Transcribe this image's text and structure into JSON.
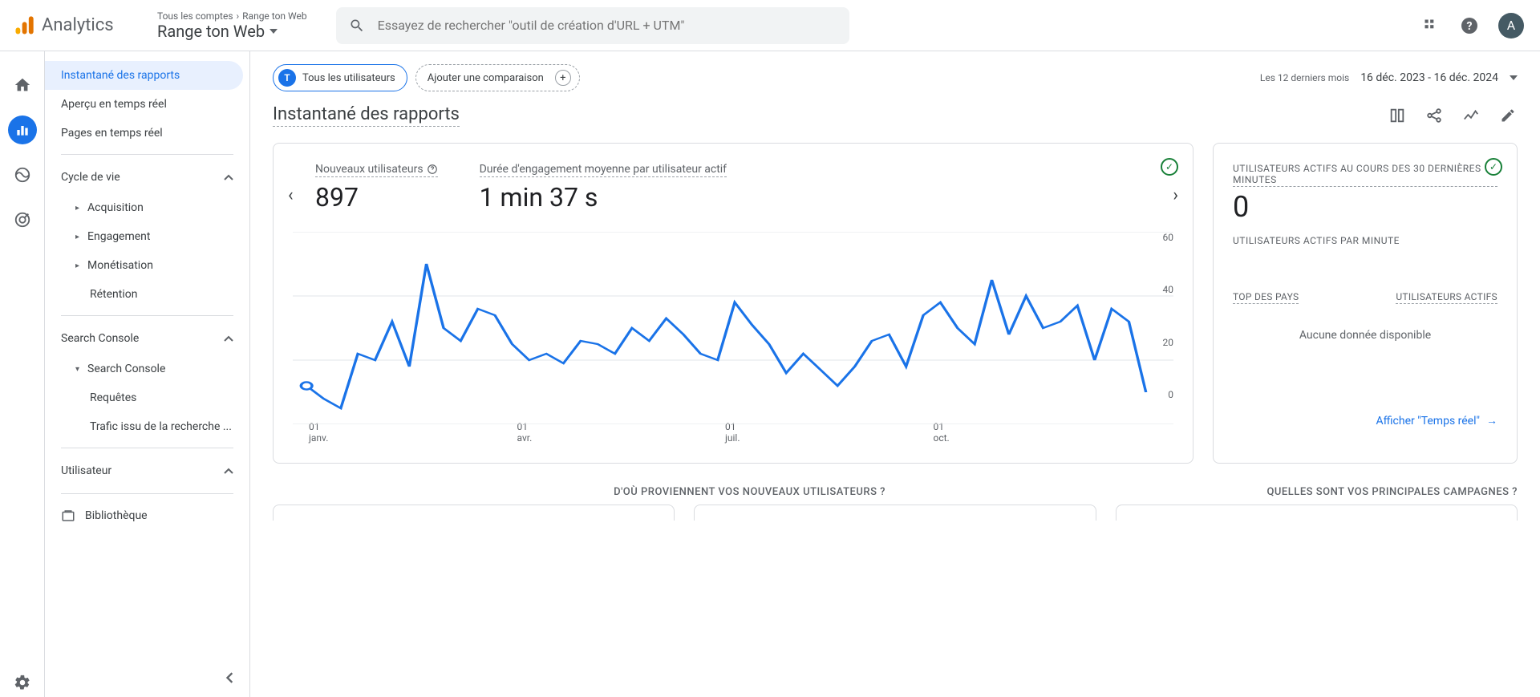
{
  "header": {
    "logo_text": "Analytics",
    "breadcrumb_all": "Tous les comptes",
    "breadcrumb_prop": "Range ton Web",
    "property_name": "Range ton Web",
    "search_placeholder": "Essayez de rechercher \"outil de création d'URL + UTM\"",
    "avatar_initial": "A"
  },
  "sidebar": {
    "items": [
      "Instantané des rapports",
      "Aperçu en temps réel",
      "Pages en temps réel"
    ],
    "group1": "Cycle de vie",
    "group1_items": [
      "Acquisition",
      "Engagement",
      "Monétisation",
      "Rétention"
    ],
    "group2": "Search Console",
    "group2_sub": "Search Console",
    "group2_items": [
      "Requêtes",
      "Trafic issu de la recherche ..."
    ],
    "group3": "Utilisateur",
    "library": "Bibliothèque"
  },
  "toolbar": {
    "chip_all": "Tous les utilisateurs",
    "chip_letter": "T",
    "chip_add": "Ajouter une comparaison",
    "date_label": "Les 12 derniers mois",
    "date_range": "16 déc. 2023 - 16 déc. 2024"
  },
  "page_title": "Instantané des rapports",
  "main_card": {
    "metrics": [
      {
        "label": "Nouveaux utilisateurs",
        "value": "897"
      },
      {
        "label": "Durée d'engagement moyenne par utilisateur actif",
        "value": "1 min 37 s"
      }
    ]
  },
  "chart_data": {
    "type": "line",
    "xlabel": "",
    "ylabel": "",
    "ylim": [
      0,
      60
    ],
    "y_ticks": [
      60,
      40,
      20,
      0
    ],
    "x_ticks": [
      "01\njanv.",
      "01\navr.",
      "01\njuil.",
      "01\noct."
    ],
    "values": [
      12,
      8,
      5,
      22,
      20,
      32,
      18,
      50,
      30,
      26,
      36,
      34,
      25,
      20,
      22,
      19,
      26,
      25,
      22,
      30,
      26,
      33,
      28,
      22,
      20,
      38,
      31,
      25,
      16,
      22,
      17,
      12,
      18,
      26,
      28,
      18,
      34,
      38,
      30,
      25,
      45,
      28,
      40,
      30,
      32,
      37,
      20,
      36,
      32,
      10
    ]
  },
  "side_card": {
    "title": "UTILISATEURS ACTIFS AU COURS DES 30 DERNIÈRES MINUTES",
    "value": "0",
    "sub": "UTILISATEURS ACTIFS PAR MINUTE",
    "col1": "TOP DES PAYS",
    "col2": "UTILISATEURS ACTIFS",
    "no_data": "Aucune donnée disponible",
    "link": "Afficher \"Temps réel\""
  },
  "sections": {
    "s1": "D'OÙ PROVIENNENT VOS NOUVEAUX UTILISATEURS ?",
    "s2": "QUELLES SONT VOS PRINCIPALES CAMPAGNES ?"
  }
}
